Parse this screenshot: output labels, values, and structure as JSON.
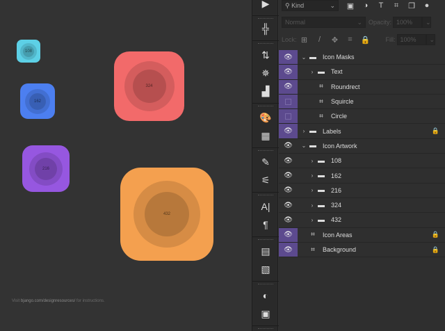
{
  "canvas": {
    "icons": [
      {
        "label": "108",
        "color": "#5dd0e6"
      },
      {
        "label": "162",
        "color": "#4c7ff0"
      },
      {
        "label": "216",
        "color": "#9657e0"
      },
      {
        "label": "324",
        "color": "#f26a6a"
      },
      {
        "label": "432",
        "color": "#f4a04f"
      }
    ],
    "footer_pre": "Visit ",
    "footer_link": "bjango.com/designresources/",
    "footer_post": " for instructions."
  },
  "panel": {
    "filter_kind": "Kind",
    "blend_mode": "Normal",
    "opacity_label": "Opacity:",
    "opacity_value": "100%",
    "lock_label": "Lock:",
    "fill_label": "Fill:",
    "fill_value": "100%"
  },
  "layers": [
    {
      "name": "Icon Masks",
      "type": "folder",
      "expanded": true,
      "indent": 0,
      "visible": true,
      "purple": true
    },
    {
      "name": "Text",
      "type": "folder",
      "expanded": false,
      "indent": 1,
      "visible": true,
      "purple": true
    },
    {
      "name": "Roundrect",
      "type": "shape",
      "indent": 1,
      "visible": true,
      "purple": true
    },
    {
      "name": "Squircle",
      "type": "shape",
      "indent": 1,
      "visible": false,
      "purple": true
    },
    {
      "name": "Circle",
      "type": "shape",
      "indent": 1,
      "visible": false,
      "purple": true
    },
    {
      "name": "Labels",
      "type": "folder",
      "expanded": false,
      "indent": 0,
      "visible": true,
      "purple": true,
      "locked": true
    },
    {
      "name": "Icon Artwork",
      "type": "folder",
      "expanded": true,
      "indent": 0,
      "visible": true,
      "purple": false
    },
    {
      "name": "108",
      "type": "folder",
      "expanded": false,
      "indent": 1,
      "visible": true,
      "purple": false
    },
    {
      "name": "162",
      "type": "folder",
      "expanded": false,
      "indent": 1,
      "visible": true,
      "purple": false
    },
    {
      "name": "216",
      "type": "folder",
      "expanded": false,
      "indent": 1,
      "visible": true,
      "purple": false
    },
    {
      "name": "324",
      "type": "folder",
      "expanded": false,
      "indent": 1,
      "visible": true,
      "purple": false
    },
    {
      "name": "432",
      "type": "folder",
      "expanded": false,
      "indent": 1,
      "visible": true,
      "purple": false
    },
    {
      "name": "Icon Areas",
      "type": "shape",
      "indent": 0,
      "visible": true,
      "purple": true,
      "locked": true
    },
    {
      "name": "Background",
      "type": "shape",
      "indent": 0,
      "visible": true,
      "purple": true,
      "locked": true
    }
  ]
}
